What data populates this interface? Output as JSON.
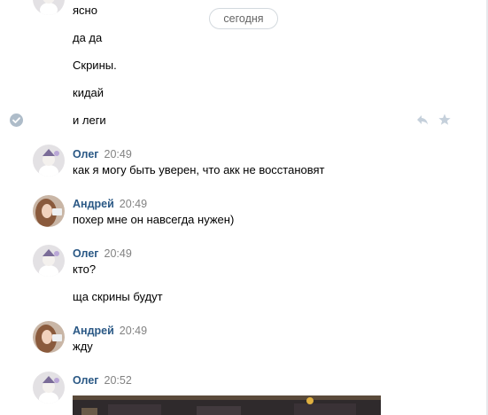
{
  "date_divider": "сегодня",
  "prev_messages": [
    "ясно",
    "да да",
    "Скрины.",
    "кидай",
    "и леги"
  ],
  "groups": [
    {
      "author": "Олег",
      "time": "20:49",
      "messages": [
        "как я могу быть уверен, что акк не восстановят"
      ]
    },
    {
      "author": "Андрей",
      "time": "20:49",
      "messages": [
        "похер мне он навсегда нужен)"
      ]
    },
    {
      "author": "Олег",
      "time": "20:49",
      "messages": [
        "кто?",
        "ща скрины будут"
      ]
    },
    {
      "author": "Андрей",
      "time": "20:49",
      "messages": [
        "жду"
      ]
    },
    {
      "author": "Олег",
      "time": "20:52",
      "messages": []
    }
  ],
  "icons": {
    "read_status": "check-circle-icon",
    "reply": "reply-icon",
    "favorite": "star-icon"
  },
  "colors": {
    "author_name": "#2a5885",
    "timestamp": "#828282",
    "status_icon": "#aebcc9",
    "action_icon": "#c5d0db"
  }
}
